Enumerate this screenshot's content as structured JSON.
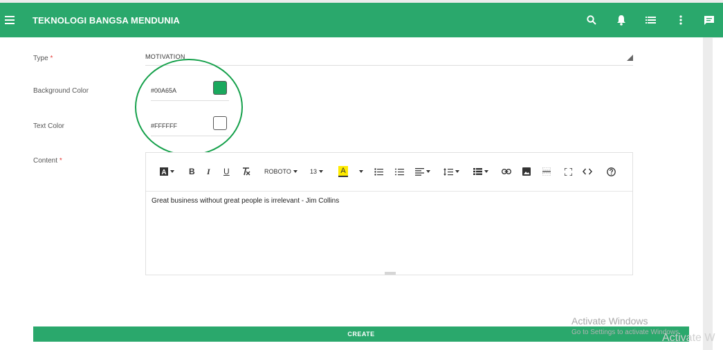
{
  "app": {
    "title": "TEKNOLOGI BANGSA MENDUNIA"
  },
  "header": {
    "icons": [
      "menu-icon",
      "search-icon",
      "bell-icon",
      "list-icon",
      "more-vert-icon",
      "chat-icon"
    ]
  },
  "form": {
    "type": {
      "label": "Type",
      "required": "*",
      "value": "MOTIVATION"
    },
    "background_color": {
      "label": "Background Color",
      "value": "#00A65A",
      "swatch": "#1aa85d"
    },
    "text_color": {
      "label": "Text Color",
      "value": "#FFFFFF",
      "swatch": "#ffffff"
    },
    "content": {
      "label": "Content",
      "required": "*",
      "text": "Great business without great people is irrelevant - Jim Collins"
    }
  },
  "toolbar": {
    "font_name": "ROBOTO",
    "font_size": "13",
    "highlight_letter": "A",
    "highlight_color": "#ffeb00",
    "bold": "B",
    "italic": "I",
    "underline": "U"
  },
  "buttons": {
    "create": "CREATE"
  },
  "watermark": {
    "line1": "Activate Windows",
    "line2": "Go to Settings to activate Windows.",
    "line3": "Activate W"
  },
  "colors": {
    "primary": "#2aa86c",
    "required": "#e53935",
    "circle": "#14a04a"
  }
}
